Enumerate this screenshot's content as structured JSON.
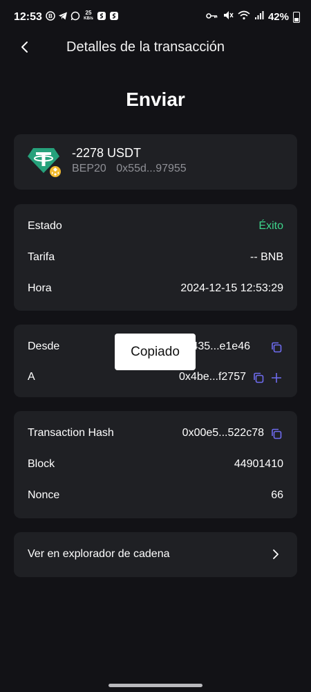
{
  "status_bar": {
    "time": "12:53",
    "speed_value": "25",
    "speed_unit": "KB/s",
    "battery": "42%"
  },
  "header": {
    "title": "Detalles de la transacción"
  },
  "page_title": "Enviar",
  "token": {
    "amount": "-2278 USDT",
    "network": "BEP20",
    "contract": "0x55d...97955",
    "icon": "tether-icon",
    "badge_icon": "bnb-icon"
  },
  "details": {
    "status_label": "Estado",
    "status_value": "Éxito",
    "fee_label": "Tarifa",
    "fee_value": "-- BNB",
    "time_label": "Hora",
    "time_value": "2024-12-15 12:53:29"
  },
  "addresses": {
    "from_label": "Desde",
    "from_value": "0x435...e1e46",
    "to_label": "A",
    "to_value": "0x4be...f2757"
  },
  "toast": "Copiado",
  "chain": {
    "hash_label": "Transaction Hash",
    "hash_value": "0x00e5...522c78",
    "block_label": "Block",
    "block_value": "44901410",
    "nonce_label": "Nonce",
    "nonce_value": "66"
  },
  "explorer": {
    "label": "Ver en explorador de cadena"
  },
  "colors": {
    "background": "#121216",
    "card": "#1f2024",
    "success": "#3dd68c",
    "accent": "#6f6cf0",
    "muted": "#8f9096"
  }
}
